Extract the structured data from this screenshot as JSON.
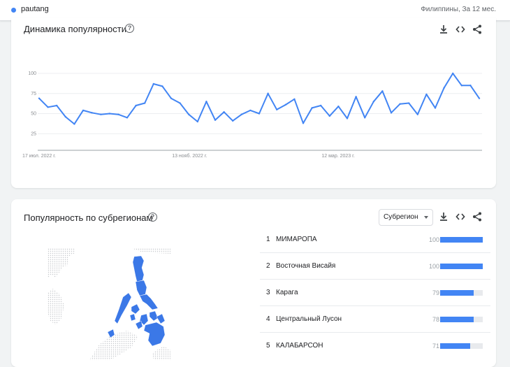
{
  "topbar": {
    "term": "pautang",
    "term_color": "#4285f4",
    "meta": "Филиппины, За 12 мес."
  },
  "interest_card": {
    "title": "Динамика популярности",
    "help_icon": "help-circle-icon",
    "tools": [
      "download-icon",
      "embed-code-icon",
      "share-icon"
    ]
  },
  "chart_data": {
    "type": "line",
    "title": "",
    "xlabel": "",
    "ylabel": "",
    "ylim": [
      0,
      100
    ],
    "yticks": [
      25,
      50,
      75,
      100
    ],
    "x_tick_labels": [
      "17 июл. 2022 г.",
      "13 нояб. 2022 г.",
      "12 мар. 2023 г."
    ],
    "x_tick_index": [
      0,
      17,
      34
    ],
    "grid": true,
    "series": [
      {
        "color": "#4285f4",
        "values": [
          69,
          58,
          60,
          46,
          37,
          54,
          51,
          49,
          50,
          49,
          45,
          60,
          63,
          87,
          84,
          69,
          63,
          49,
          40,
          65,
          42,
          52,
          41,
          49,
          54,
          50,
          75,
          55,
          61,
          68,
          38,
          57,
          60,
          47,
          59,
          44,
          71,
          45,
          65,
          78,
          51,
          62,
          63,
          49,
          74,
          57,
          82,
          100,
          85,
          85,
          69
        ]
      }
    ]
  },
  "region_card": {
    "title": "Популярность по субрегионам",
    "help_icon": "help-circle-icon",
    "select_label": "Субрегион",
    "tools": [
      "download-icon",
      "embed-code-icon",
      "share-icon"
    ],
    "bar_color": "#4285f4",
    "regions": [
      {
        "rank": "1",
        "name": "МИМАРОПА",
        "value": "100",
        "level": 100
      },
      {
        "rank": "2",
        "name": "Восточная Висайя",
        "value": "100",
        "level": 100
      },
      {
        "rank": "3",
        "name": "Карага",
        "value": "79",
        "level": 79
      },
      {
        "rank": "4",
        "name": "Центральный Лусон",
        "value": "78",
        "level": 78
      },
      {
        "rank": "5",
        "name": "КАЛАБАРСОН",
        "value": "71",
        "level": 71
      }
    ]
  }
}
